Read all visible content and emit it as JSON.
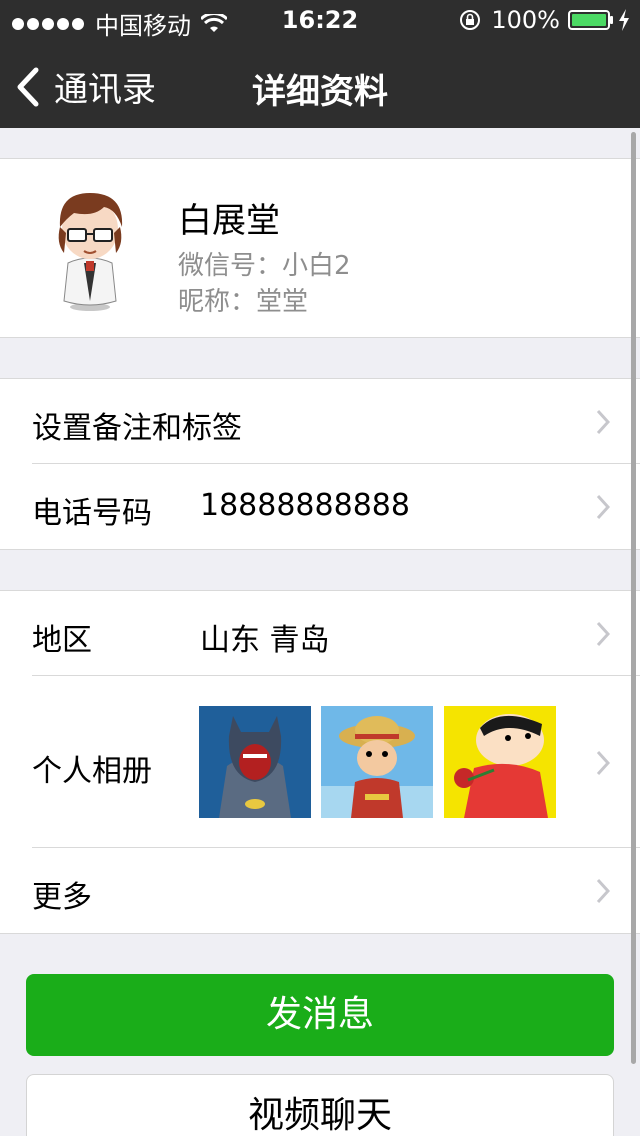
{
  "status_bar": {
    "carrier": "中国移动",
    "time": "16:22",
    "battery": "100%",
    "battery_color": "#4cd964"
  },
  "nav": {
    "back_label": "通讯录",
    "title": "详细资料",
    "background": "#2e2e2e"
  },
  "profile": {
    "name": "白展堂",
    "wechat_id": "微信号：小白2",
    "nickname": "昵称：堂堂",
    "avatar_icon": "cartoon-avatar"
  },
  "rows": {
    "remark": {
      "label": "设置备注和标签"
    },
    "phone": {
      "label": "电话号码",
      "value": "18888888888"
    },
    "region": {
      "label": "地区",
      "value": "山东 青岛"
    },
    "album": {
      "label": "个人相册",
      "thumbs": [
        "batman-cartoon",
        "luffy-cartoon",
        "shinchan-cartoon"
      ]
    },
    "more": {
      "label": "更多"
    }
  },
  "actions": {
    "send_message": "发消息",
    "video_chat": "视频聊天",
    "accent": "#1aad19"
  }
}
